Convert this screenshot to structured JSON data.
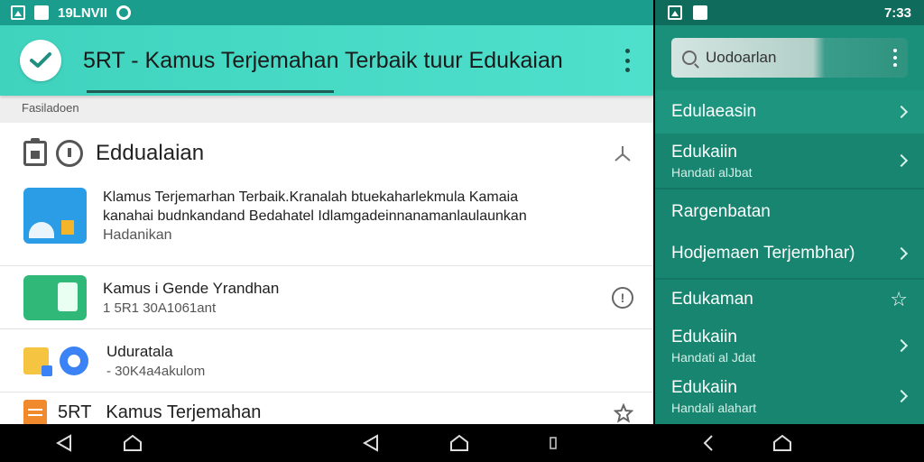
{
  "left_status": {
    "time": "19LNVII"
  },
  "toolbar": {
    "title": "5RT - Kamus Terjemahan Terbaik tuur Edukaian"
  },
  "section_label": "Fasiladoen",
  "card": {
    "title": "Eddualaian"
  },
  "items": [
    {
      "lines": [
        "Klamus Terjemarhan Terbaik.Kranalah btuekaharlekmula Kamaia",
        "kanahai budnkandand Bedahatel Idlamgadeinnanamanlaulaunkan",
        "Hadanikan"
      ]
    },
    {
      "primary": "Kamus i Gende Yrandhan",
      "secondary": "1 5R1 30A1061ant"
    },
    {
      "primary": "Uduratala",
      "secondary": "- 30K4a4akulom"
    },
    {
      "prefix": "5RT",
      "primary": "Kamus Terjemahan"
    }
  ],
  "right_status": {
    "time": "7:33"
  },
  "search": {
    "placeholder": "Uodoarlan"
  },
  "menu": [
    {
      "label": "Edulaeasin",
      "chevron": true,
      "highlight": true
    },
    {
      "label": "Edukaiin",
      "sub": "Handati alJbat",
      "chevron": true
    },
    {
      "label": "Rargenbatan",
      "chevron": false
    },
    {
      "label": "Hodjemaen Terjembhar)",
      "chevron": true
    },
    {
      "label": "Edukaman",
      "star": true
    },
    {
      "label": "Edukaiin",
      "sub": "Handati al Jdat",
      "chevron": true
    },
    {
      "label": "Edukaiin",
      "sub": "Handali alahart",
      "chevron": true
    }
  ]
}
